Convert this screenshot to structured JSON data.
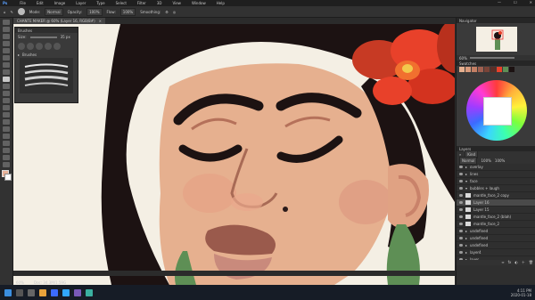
{
  "title_bar": {
    "doc_title": "CHANTE MAKER @ 60% (Layer 16, RGB/8#)",
    "menu": [
      "File",
      "Edit",
      "Image",
      "Layer",
      "Type",
      "Select",
      "Filter",
      "3D",
      "View",
      "Window",
      "Help"
    ]
  },
  "options_bar": {
    "mode_label": "Normal",
    "opacity_label": "Opacity:",
    "opacity_value": "100%",
    "flow_label": "Flow:",
    "flow_value": "100%",
    "smoothing_label": "Smoothing:"
  },
  "brushes_panel": {
    "title": "Brushes",
    "size_label": "Size:",
    "size_value": "35 px",
    "group_label": "Brushes"
  },
  "navigator": {
    "title": "Navigator",
    "zoom": "60%"
  },
  "swatches": {
    "title": "Swatches"
  },
  "layers": {
    "title": "Layers",
    "kind_label": "Kind",
    "blend_mode": "Normal",
    "opacity": "100%",
    "fill": "100%",
    "items": [
      {
        "name": "overlay"
      },
      {
        "name": "lines"
      },
      {
        "name": "face"
      },
      {
        "name": "bubbles + laugh"
      },
      {
        "name": "mantle_face_2 copy"
      },
      {
        "name": "Layer 16"
      },
      {
        "name": "Layer 15"
      },
      {
        "name": "mantle_face_2 (blah)"
      },
      {
        "name": "mantle_face_2"
      },
      {
        "name": "undefined"
      },
      {
        "name": "undefined"
      },
      {
        "name": "undefined"
      },
      {
        "name": "layer4"
      },
      {
        "name": "layer"
      }
    ]
  },
  "status_bar": {
    "zoom": "60%",
    "doc": "Doc: 34.3M/1.59G"
  },
  "taskbar": {
    "time": "4:11 PM",
    "date": "2020-01-18"
  },
  "colors": {
    "accent": "#1473e6",
    "skin": "#e6b08f",
    "hair": "#1c1212",
    "flower": "#e8412a",
    "earring": "#5e8f55",
    "canvas_bg": "#f4efe4"
  }
}
